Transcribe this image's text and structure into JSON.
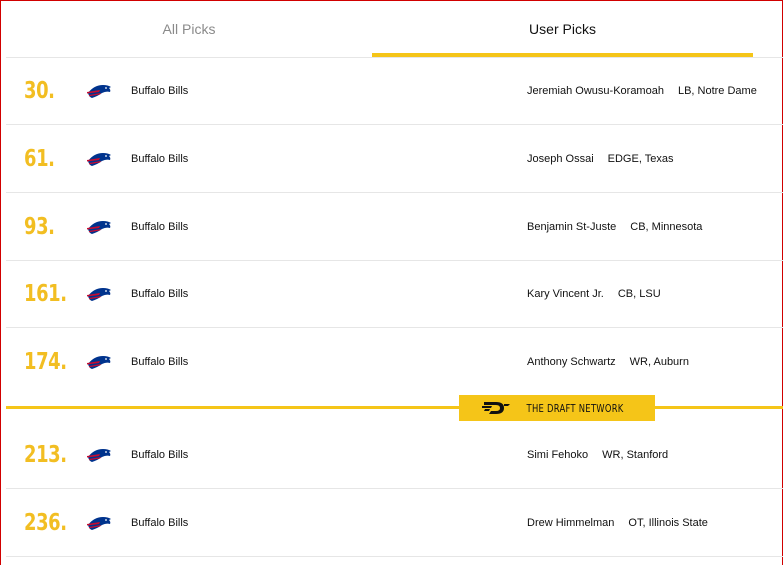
{
  "tabs": [
    {
      "label": "All Picks",
      "active": false
    },
    {
      "label": "User Picks",
      "active": true
    }
  ],
  "accent_color": "#f5c518",
  "brand": {
    "text": "THE DRAFT NETWORK",
    "icon": "draft-network-logo-icon"
  },
  "team_logo_icon": "buffalo-bills-logo-icon",
  "picks": [
    {
      "number": "30.",
      "team": "Buffalo Bills",
      "player": "Jeremiah Owusu-Koramoah",
      "position": "LB, Notre Dame"
    },
    {
      "number": "61.",
      "team": "Buffalo Bills",
      "player": "Joseph Ossai",
      "position": "EDGE, Texas"
    },
    {
      "number": "93.",
      "team": "Buffalo Bills",
      "player": "Benjamin St-Juste",
      "position": "CB, Minnesota"
    },
    {
      "number": "161.",
      "team": "Buffalo Bills",
      "player": "Kary Vincent Jr.",
      "position": "CB, LSU"
    },
    {
      "number": "174.",
      "team": "Buffalo Bills",
      "player": "Anthony Schwartz",
      "position": "WR, Auburn"
    },
    {
      "number": "213.",
      "team": "Buffalo Bills",
      "player": "Simi Fehoko",
      "position": "WR, Stanford"
    },
    {
      "number": "236.",
      "team": "Buffalo Bills",
      "player": "Drew Himmelman",
      "position": "OT, Illinois State"
    }
  ]
}
